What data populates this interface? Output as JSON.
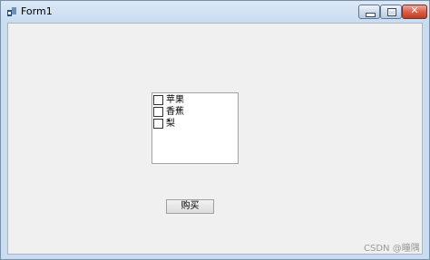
{
  "window": {
    "title": "Form1"
  },
  "checklist": {
    "items": [
      {
        "label": "苹果",
        "checked": false
      },
      {
        "label": "香蕉",
        "checked": false
      },
      {
        "label": "梨",
        "checked": false
      }
    ]
  },
  "buy_button": {
    "label": "购买"
  },
  "watermark": {
    "text": "CSDN @瞳隅"
  },
  "colors": {
    "form_background": "#f0f0f0",
    "frame": "#c9dcf0",
    "close_button": "#c23b22"
  }
}
